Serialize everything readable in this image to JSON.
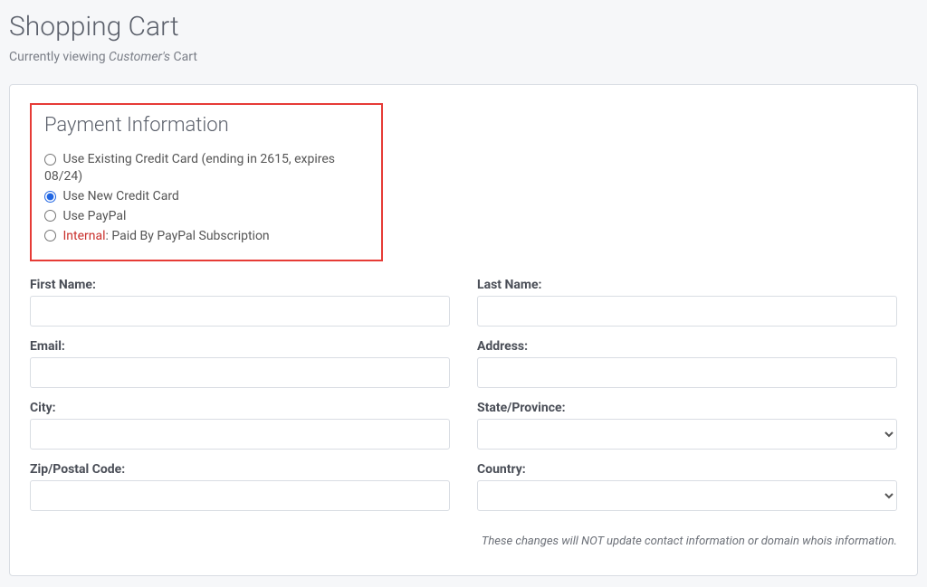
{
  "header": {
    "title": "Shopping Cart",
    "subtitle_prefix": "Currently viewing ",
    "subtitle_italic": "Customer's",
    "subtitle_suffix": " Cart"
  },
  "payment": {
    "section_title": "Payment Information",
    "options": {
      "existing": "Use Existing Credit Card (ending in 2615, expires 08/24)",
      "new": "Use New Credit Card",
      "paypal": "Use PayPal",
      "internal_prefix": "Internal",
      "internal_rest": ": Paid By PayPal Subscription"
    },
    "selected": "new"
  },
  "form": {
    "first_name": {
      "label": "First Name:",
      "value": ""
    },
    "last_name": {
      "label": "Last Name:",
      "value": ""
    },
    "email": {
      "label": "Email:",
      "value": ""
    },
    "address": {
      "label": "Address:",
      "value": ""
    },
    "city": {
      "label": "City:",
      "value": ""
    },
    "state": {
      "label": "State/Province:",
      "value": ""
    },
    "zip": {
      "label": "Zip/Postal Code:",
      "value": ""
    },
    "country": {
      "label": "Country:",
      "value": ""
    }
  },
  "note": "These changes will NOT update contact information or domain whois information."
}
